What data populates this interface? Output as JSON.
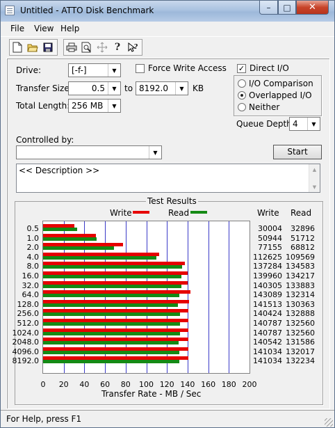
{
  "window": {
    "title": "Untitled - ATTO Disk Benchmark"
  },
  "menu": [
    "File",
    "View",
    "Help"
  ],
  "toolbar_icons": [
    "new-icon",
    "open-icon",
    "save-icon",
    "print-icon",
    "print-preview-icon",
    "move-icon",
    "help-icon",
    "context-help-icon"
  ],
  "settings": {
    "drive_label": "Drive:",
    "drive_value": "[-f-]",
    "transfer_size_label": "Transfer Size:",
    "transfer_from": "0.5",
    "transfer_to_label": "to",
    "transfer_to": "8192.0",
    "transfer_unit": "KB",
    "total_length_label": "Total Length:",
    "total_length": "256 MB",
    "force_write_label": "Force Write Access",
    "force_write_checked": false,
    "direct_io_label": "Direct I/O",
    "direct_io_checked": true,
    "io_options": [
      {
        "label": "I/O Comparison",
        "selected": false
      },
      {
        "label": "Overlapped I/O",
        "selected": true
      },
      {
        "label": "Neither",
        "selected": false
      }
    ],
    "queue_depth_label": "Queue Depth:",
    "queue_depth": "4",
    "controlled_by_label": "Controlled by:",
    "controlled_by_value": "",
    "start_label": "Start",
    "description": "<< Description >>"
  },
  "results": {
    "title": "Test Results",
    "write_legend": "Write",
    "read_legend": "Read",
    "write_col_header": "Write",
    "read_col_header": "Read",
    "xlabel": "Transfer Rate - MB / Sec",
    "write_color": "#e60000",
    "read_color": "#158a15"
  },
  "chart_data": {
    "type": "bar",
    "orientation": "horizontal",
    "categories": [
      "0.5",
      "1.0",
      "2.0",
      "4.0",
      "8.0",
      "16.0",
      "32.0",
      "64.0",
      "128.0",
      "256.0",
      "512.0",
      "1024.0",
      "2048.0",
      "4096.0",
      "8192.0"
    ],
    "series": [
      {
        "name": "Write",
        "values": [
          30004,
          50944,
          77155,
          112625,
          137284,
          139960,
          140305,
          143089,
          141513,
          140424,
          140787,
          140787,
          140542,
          141034,
          141034
        ]
      },
      {
        "name": "Read",
        "values": [
          32896,
          51712,
          68812,
          109569,
          134583,
          134217,
          133883,
          132314,
          130363,
          132888,
          132560,
          132560,
          131586,
          132017,
          132234
        ]
      }
    ],
    "xlabel": "Transfer Rate - MB / Sec",
    "xlim": [
      0,
      200
    ],
    "xticks": [
      "0",
      "20",
      "40",
      "60",
      "80",
      "100",
      "120",
      "140",
      "160",
      "180",
      "200"
    ]
  },
  "status": {
    "text": "For Help, press F1"
  }
}
